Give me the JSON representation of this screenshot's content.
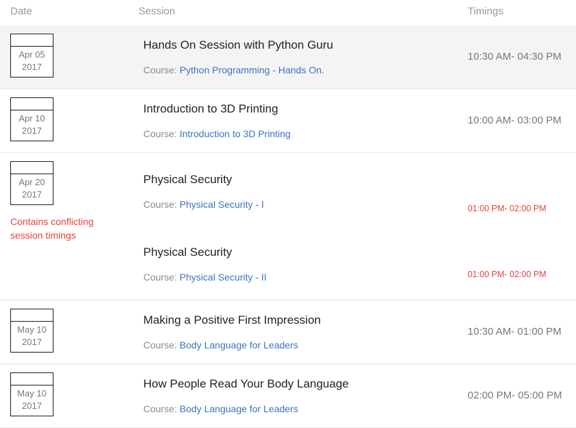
{
  "header": {
    "date_label": "Date",
    "session_label": "Session",
    "timings_label": "Timings"
  },
  "labels": {
    "course_prefix": "Course:",
    "conflict_note": "Contains conflicting session timings"
  },
  "colors": {
    "link": "#3b73b9",
    "conflict": "#e8413a",
    "muted": "#8a8a8a",
    "row_highlight": "#f4f4f4",
    "border": "#e6e6e6"
  },
  "rows": [
    {
      "date_month_day": "Apr 05",
      "date_year": "2017",
      "highlight": true,
      "conflict": false,
      "sessions": [
        {
          "title": "Hands On Session with Python Guru",
          "course": "Python Programming - Hands On.",
          "timing": "10:30 AM- 04:30 PM"
        }
      ]
    },
    {
      "date_month_day": "Apr 10",
      "date_year": "2017",
      "highlight": false,
      "conflict": false,
      "sessions": [
        {
          "title": "Introduction to 3D Printing",
          "course": "Introduction to 3D Printing",
          "timing": "10:00 AM- 03:00 PM"
        }
      ]
    },
    {
      "date_month_day": "Apr 20",
      "date_year": "2017",
      "highlight": false,
      "conflict": true,
      "sessions": [
        {
          "title": "Physical Security",
          "course": "Physical Security - I",
          "timing": "01:00 PM- 02:00 PM"
        },
        {
          "title": "Physical Security",
          "course": "Physical Security - II",
          "timing": "01:00 PM- 02:00 PM"
        }
      ]
    },
    {
      "date_month_day": "May 10",
      "date_year": "2017",
      "highlight": false,
      "conflict": false,
      "sessions": [
        {
          "title": "Making a Positive First Impression",
          "course": "Body Language for Leaders",
          "timing": "10:30 AM- 01:00 PM"
        }
      ]
    },
    {
      "date_month_day": "May 10",
      "date_year": "2017",
      "highlight": false,
      "conflict": false,
      "sessions": [
        {
          "title": "How People Read Your Body Language",
          "course": "Body Language for Leaders",
          "timing": "02:00 PM- 05:00 PM"
        }
      ]
    }
  ]
}
